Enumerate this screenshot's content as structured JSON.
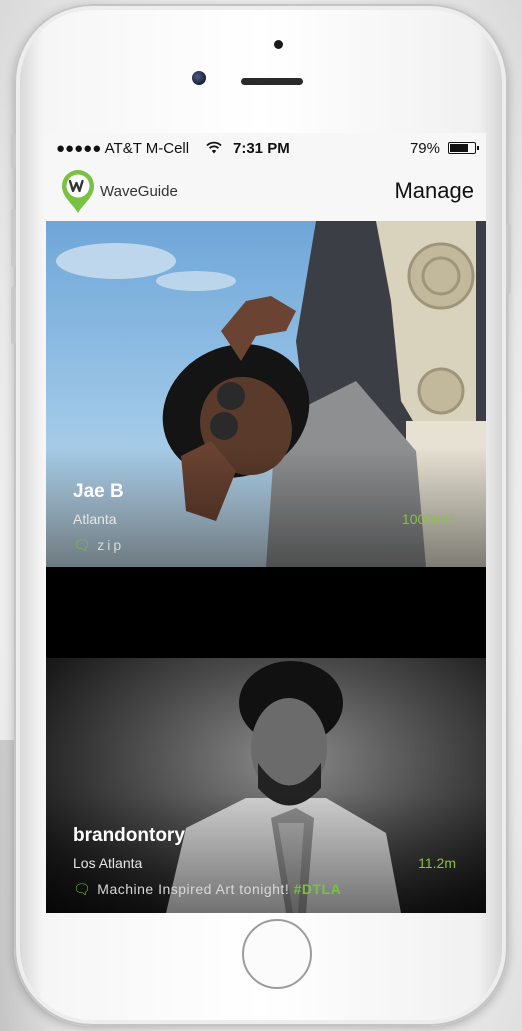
{
  "status_bar": {
    "carrier": "●●●●● AT&T M-Cell",
    "wifi_icon": "wifi-icon",
    "time": "7:31 PM",
    "battery": "79%",
    "battery_level": 0.79
  },
  "nav": {
    "brand": "WaveGuide",
    "action": "Manage",
    "logo_color": "#7ac143"
  },
  "feed": [
    {
      "name": "Jae B",
      "location": "Atlanta",
      "distance": "1000mi+",
      "message": "zip",
      "hashtag": ""
    },
    {
      "name": "brandontory",
      "location": "Los Atlanta",
      "distance": "11.2m",
      "message": "Machine Inspired Art tonight!",
      "hashtag": "#DTLA"
    }
  ],
  "colors": {
    "accent": "#7ac143",
    "distance": "#8dbf45"
  }
}
